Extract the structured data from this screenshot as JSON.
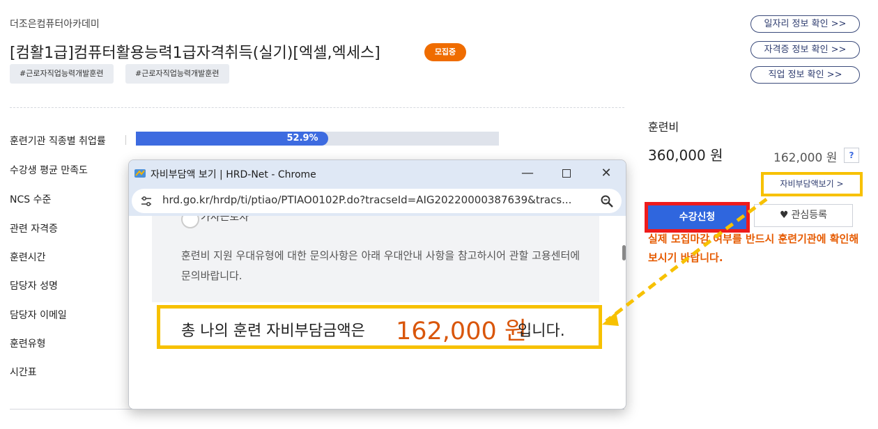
{
  "header": {
    "academy": "더조은컴퓨터아카데미",
    "title": "[컴활1급]컴퓨터활용능력1급자격취득(실기)[엑셀,엑세스]",
    "badge": "모집중",
    "tags": [
      "#근로자직업능력개발훈련",
      "#근로자직업능력개발훈련"
    ]
  },
  "info_links": [
    "일자리 정보 확인 >>",
    "자격증 정보 확인 >>",
    "직업 정보 확인 >>"
  ],
  "details": {
    "rows": [
      "훈련기관 직종별 취업률",
      "수강생 평균 만족도",
      "NCS 수준",
      "관련 자격증",
      "훈련시간",
      "담당자 성명",
      "담당자 이메일",
      "훈련유형",
      "시간표"
    ],
    "employment_rate_text": "52.9%",
    "employment_rate_value": 52.9
  },
  "fee": {
    "label": "훈련비",
    "amount": "360,000 원",
    "self_amount": "162,000 원",
    "help": "?",
    "self_view_button": "자비부담액보기 >",
    "apply_button": "수강신청",
    "wish_button": "관심등록",
    "notice": "실제 모집마감 여부를 반드시 훈련기관에 확인해보시기 바랍니다."
  },
  "popup": {
    "title": "자비부담액 보기 | HRD-Net - Chrome",
    "url": "hrd.go.kr/hrdp/ti/ptiao/PTIAO0102P.do?tracseId=AIG20220000387639&tracs...",
    "radio_label": "가사근로자",
    "notice_text": "훈련비 지원 우대유형에 대한 문의사항은 아래 우대안내 사항을 참고하시어 관할 고용센터에 문의바랍니다.",
    "total_prefix": "총 나의 훈련 자비부담금액은",
    "total_amount": "162,000 원",
    "total_suffix": "입니다."
  },
  "colors": {
    "accent_blue": "#3d6be0",
    "badge_orange": "#ef6c00",
    "highlight_yellow": "#f7c100",
    "highlight_red": "#ee1c1c",
    "notice_orange": "#e65a00"
  },
  "icons": {
    "chrome_app": "hrd-net-favicon",
    "site_settings": "tune-icon",
    "zoom": "zoom-icon",
    "wish": "heart-icon"
  }
}
